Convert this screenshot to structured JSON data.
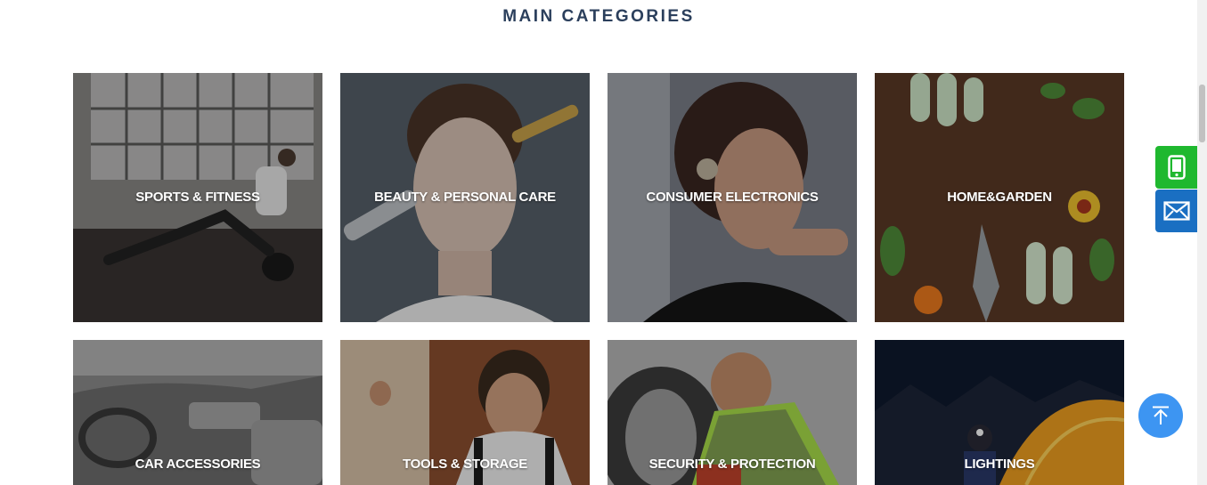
{
  "section": {
    "title": "MAIN CATEGORIES"
  },
  "categories": [
    {
      "label": "SPORTS & FITNESS",
      "icon": "sports-fitness-photo"
    },
    {
      "label": "BEAUTY & PERSONAL CARE",
      "icon": "beauty-care-photo"
    },
    {
      "label": "CONSUMER ELECTRONICS",
      "icon": "consumer-electronics-photo"
    },
    {
      "label": "HOME&GARDEN",
      "icon": "home-garden-photo"
    },
    {
      "label": "CAR ACCESSORIES",
      "icon": "car-accessories-photo"
    },
    {
      "label": "TOOLS & STORAGE",
      "icon": "tools-storage-photo"
    },
    {
      "label": "SECURITY & PROTECTION",
      "icon": "security-protection-photo"
    },
    {
      "label": "LIGHTINGS",
      "icon": "lightings-photo"
    }
  ],
  "contact": {
    "phone_icon": "mobile-phone-icon",
    "mail_icon": "envelope-icon",
    "phone_color": "#1fb82f",
    "mail_color": "#1a6fc2"
  },
  "back_to_top": {
    "icon": "arrow-up-icon",
    "color": "#3d95f2"
  }
}
